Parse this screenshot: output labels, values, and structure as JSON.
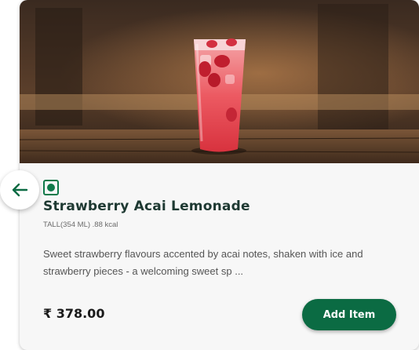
{
  "product": {
    "name": "Strawberry Acai Lemonade",
    "meta": "TALL(354 ML) .88 kcal",
    "description": "Sweet strawberry flavours accented by acai notes, shaken with ice and strawberry pieces - a welcoming sweet sp ...",
    "price": "₹ 378.00",
    "veg_indicator": "veg-icon"
  },
  "actions": {
    "add_label": "Add Item",
    "back_icon": "arrow-left-icon"
  },
  "colors": {
    "brand_green": "#0b6b43",
    "title_color": "#1e3932"
  }
}
